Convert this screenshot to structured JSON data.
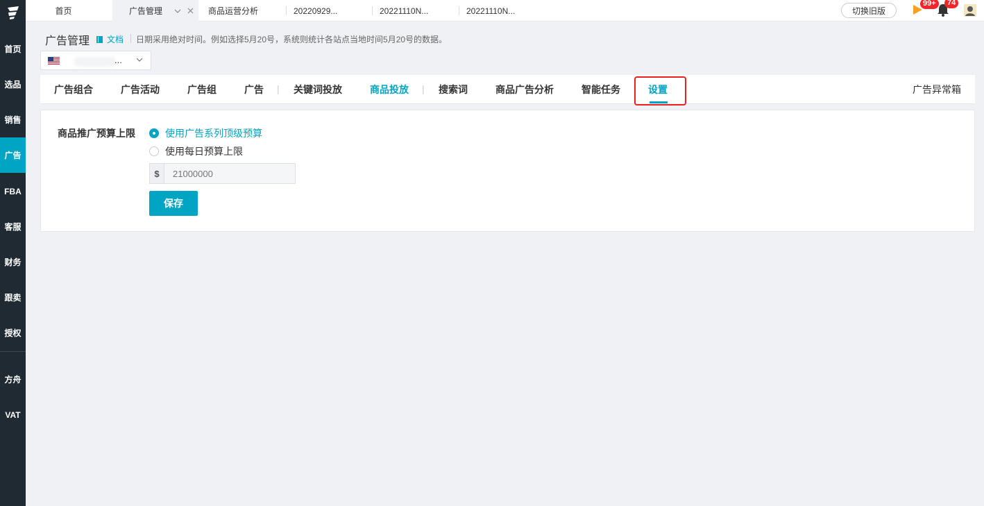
{
  "sidebar": {
    "items": [
      {
        "label": "首页"
      },
      {
        "label": "选品"
      },
      {
        "label": "销售"
      },
      {
        "label": "广告",
        "active": true
      },
      {
        "label": "FBA"
      },
      {
        "label": "客服"
      },
      {
        "label": "财务"
      },
      {
        "label": "跟卖"
      },
      {
        "label": "授权"
      },
      {
        "label": "方舟"
      },
      {
        "label": "VAT"
      }
    ]
  },
  "top_tabs": [
    {
      "label": "首页"
    },
    {
      "label": "广告管理",
      "active": true
    },
    {
      "label": "商品运营分析"
    },
    {
      "label": "20220929..."
    },
    {
      "label": "20221110N..."
    },
    {
      "label": "20221110N..."
    }
  ],
  "topbar": {
    "switch_old_label": "切换旧版",
    "play_badge": "99+",
    "bell_badge": "74"
  },
  "header": {
    "title": "广告管理",
    "doc_label": "文档",
    "hint": "日期采用绝对时间。例如选择5月20号，系统则统计各站点当地时间5月20号的数据。"
  },
  "country_select": {
    "ellipsis": "..."
  },
  "nav_tabs": [
    {
      "label": "广告组合"
    },
    {
      "label": "广告活动"
    },
    {
      "label": "广告组"
    },
    {
      "label": "广告"
    },
    {
      "label": "关键词投放"
    },
    {
      "label": "商品投放",
      "highlight": true
    },
    {
      "label": "搜索词"
    },
    {
      "label": "商品广告分析"
    },
    {
      "label": "智能任务"
    },
    {
      "label": "设置",
      "active": true
    }
  ],
  "nav_right_label": "广告异常箱",
  "settings": {
    "field_label": "商品推广预算上限",
    "options": [
      {
        "label": "使用广告系列顶级预算",
        "checked": true
      },
      {
        "label": "使用每日预算上限",
        "checked": false
      }
    ],
    "currency_symbol": "$",
    "budget_placeholder": "21000000",
    "save_label": "保存"
  },
  "colors": {
    "accent": "#00a5c3",
    "sidebar_bg": "#1f2a33",
    "highlight_red": "#e8231f",
    "badge_red": "#f0262a"
  }
}
